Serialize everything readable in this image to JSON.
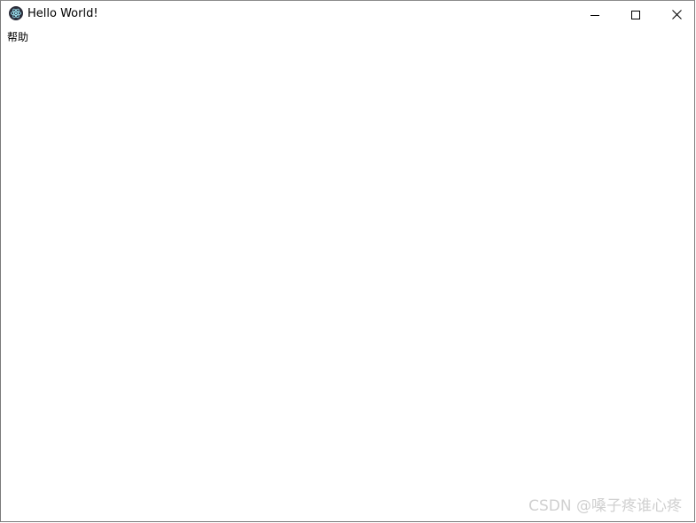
{
  "window": {
    "title": "Hello World!",
    "app_icon": "electron-atom-icon",
    "controls": {
      "minimize_icon": "minimize-icon",
      "maximize_icon": "maximize-icon",
      "close_icon": "close-icon"
    }
  },
  "menubar": {
    "items": [
      {
        "label": "帮助"
      }
    ]
  },
  "watermark": {
    "text": "CSDN @嗓子疼谁心疼"
  },
  "colors": {
    "background": "#ffffff",
    "text": "#000000",
    "icon_dark": "#2b2e3b",
    "icon_accent": "#9feaf9",
    "watermark": "#d0d0d0"
  }
}
